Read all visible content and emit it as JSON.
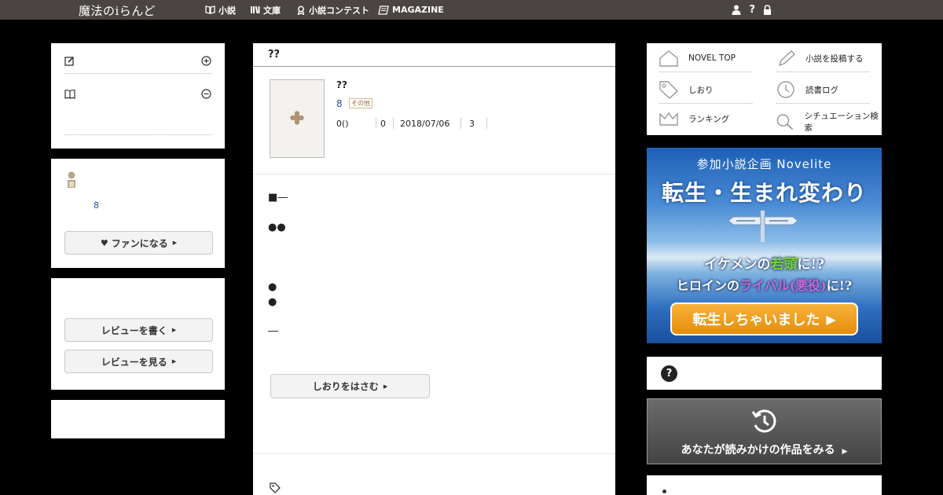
{
  "header": {
    "logo": "魔法のiらんど",
    "nav": [
      {
        "label": "小説",
        "icon": "book-icon"
      },
      {
        "label": "文庫",
        "icon": "library-icon"
      },
      {
        "label": "小説コンテスト",
        "icon": "award-icon"
      },
      {
        "label": "MAGAZINE",
        "icon": "magazine-icon"
      }
    ],
    "icons": [
      "user-icon",
      "help-icon",
      "lock-icon"
    ]
  },
  "left": {
    "author_count": "8",
    "fan_button": "ファンになる",
    "review_write": "レビューを書く",
    "review_view": "レビューを見る"
  },
  "work": {
    "header_title": "??",
    "title": "??",
    "author_count": "8",
    "genre_tag": "その他",
    "stats": [
      "0()",
      "0",
      "2018/07/06",
      "3"
    ],
    "lines": [
      "■―",
      "●●",
      "●",
      "●",
      "―"
    ],
    "bookmark_button": "しおりをはさむ"
  },
  "right": {
    "menu": [
      {
        "label": "NOVEL TOP",
        "icon": "house-icon"
      },
      {
        "label": "小説を投稿する",
        "icon": "pencil-icon"
      },
      {
        "label": "しおり",
        "icon": "tag-icon"
      },
      {
        "label": "読書ログ",
        "icon": "history-icon"
      },
      {
        "label": "ランキング",
        "icon": "crown-icon"
      },
      {
        "label": "シチュエーション検索",
        "icon": "search-icon"
      }
    ],
    "banner": {
      "line1": "参加小説企画 Novelite",
      "line2": "転生・生まれ変わり",
      "line3_a": "イケメンの",
      "line3_b": "若頭",
      "line3_c": "に!?",
      "line4_a": "ヒロインの",
      "line4_b": "ライバル(悪役)",
      "line4_c": "に!?",
      "button": "転生しちゃいました"
    },
    "help_icon": "?",
    "history_label": "あなたが読みかけの作品をみる"
  },
  "colors": {
    "topbar": "#4a4542",
    "author_link": "#2a4fa0",
    "tag": "#a0642c",
    "banner_orange": "#f0a020",
    "banner_green": "#7bd23c",
    "banner_purple": "#c86ad8"
  }
}
